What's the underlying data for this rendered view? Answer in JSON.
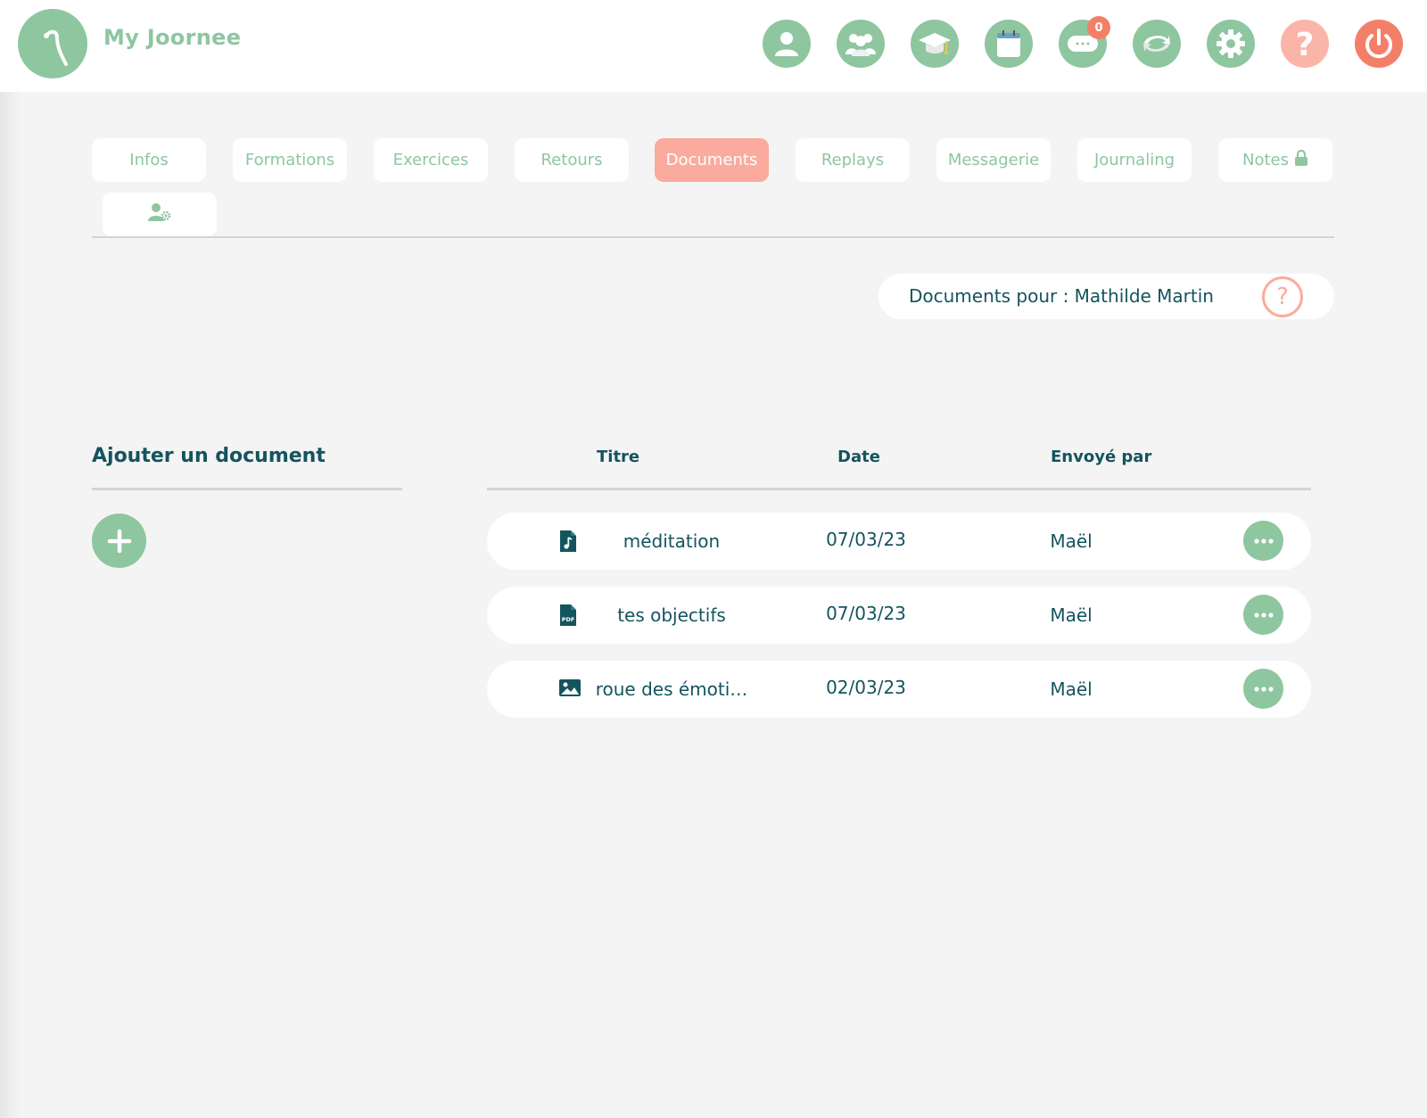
{
  "header": {
    "app_title": "My Joornee",
    "icons": [
      {
        "name": "profile-icon"
      },
      {
        "name": "group-icon"
      },
      {
        "name": "graduation-cap-icon"
      },
      {
        "name": "calendar-icon"
      },
      {
        "name": "messages-icon",
        "badge": "0"
      },
      {
        "name": "sync-icon"
      },
      {
        "name": "settings-icon"
      },
      {
        "name": "help-icon"
      },
      {
        "name": "power-icon"
      }
    ]
  },
  "tabs": [
    {
      "label": "Infos"
    },
    {
      "label": "Formations"
    },
    {
      "label": "Exercices"
    },
    {
      "label": "Retours"
    },
    {
      "label": "Documents",
      "active": true
    },
    {
      "label": "Replays"
    },
    {
      "label": "Messagerie"
    },
    {
      "label": "Journaling"
    },
    {
      "label": "Notes",
      "icon": "lock-icon"
    },
    {
      "label": "",
      "icon": "user-settings-icon"
    }
  ],
  "documents_for": {
    "label": "Documents pour : Mathilde Martin",
    "help_symbol": "?"
  },
  "add_document": {
    "title": "Ajouter un document"
  },
  "table": {
    "headers": {
      "title": "Titre",
      "date": "Date",
      "sent_by": "Envoyé par"
    },
    "rows": [
      {
        "icon": "audio-file-icon",
        "title": "méditation",
        "date": "07/03/23",
        "sent_by": "Maël"
      },
      {
        "icon": "pdf-file-icon",
        "title": "tes objectifs",
        "date": "07/03/23",
        "sent_by": "Maël"
      },
      {
        "icon": "image-icon",
        "title": "roue des émoti…",
        "date": "02/03/23",
        "sent_by": "Maël"
      }
    ]
  },
  "colors": {
    "green": "#8ec6a0",
    "salmon": "#fbab9d",
    "red": "#f47f68",
    "teal_text": "#14545e",
    "background": "#f4f4f4"
  }
}
